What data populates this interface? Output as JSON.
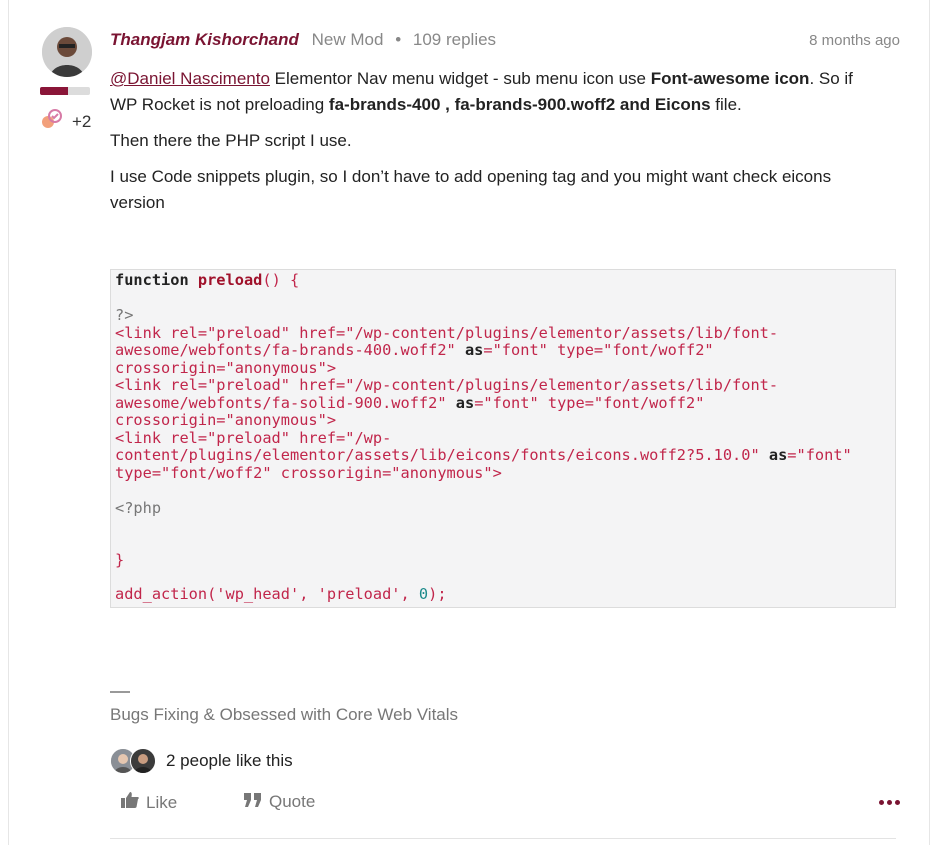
{
  "post": {
    "author": "Thangjam Kishorchand",
    "role": "New Mod",
    "separator": "•",
    "replies": "109 replies",
    "time": "8 months ago",
    "reputation_fraction": 0.55,
    "badge_count": "+2",
    "mention": "@Daniel Nascimento",
    "p1_text1": " Elementor Nav menu widget - sub menu icon use ",
    "p1_bold1": "Font-awesome icon",
    "p1_text2": ". So if WP Rocket is not preloading ",
    "p1_bold2": "fa-brands-400 , fa-brands-900.woff2 and Eicons",
    "p1_text3": " file.",
    "p2": "Then there the PHP script I use.",
    "p3": "I use Code snippets plugin, so I don’t have to add opening tag and you might want check eicons version"
  },
  "code": {
    "l1_kw": "function ",
    "l1_fn": "preload",
    "l1_rest": "() {",
    "l2": "?>",
    "l3": "<link rel=\"preload\" href=\"/wp-content/plugins/elementor/assets/lib/font-",
    "l4a": "awesome/webfonts/fa-brands-400.woff2\" ",
    "l4b": "as",
    "l4c": "=\"font\" type=\"font/woff2\"",
    "l5": "crossorigin=\"anonymous\">",
    "l6": "<link rel=\"preload\" href=\"/wp-content/plugins/elementor/assets/lib/font-",
    "l7a": "awesome/webfonts/fa-solid-900.woff2\" ",
    "l7b": "as",
    "l7c": "=\"font\" type=\"font/woff2\"",
    "l8": "crossorigin=\"anonymous\">",
    "l9": "<link rel=\"preload\" href=\"/wp-",
    "l10a": "content/plugins/elementor/assets/lib/eicons/fonts/eicons.woff2?5.10.0\" ",
    "l10b": "as",
    "l10c": "=\"font\"",
    "l11": "type=\"font/woff2\" crossorigin=\"anonymous\">",
    "l12": "<?php",
    "l13": "}",
    "l14a": "add_action('wp_head', 'preload', ",
    "l14b": "0",
    "l14c": ");"
  },
  "signature": "Bugs Fixing & Obsessed with Core Web Vitals",
  "likes_text": "2 people like this",
  "actions": {
    "like": "Like",
    "quote": "Quote"
  },
  "colors": {
    "accent": "#7a1432",
    "code_red": "#c1264b",
    "muted": "#888888"
  }
}
